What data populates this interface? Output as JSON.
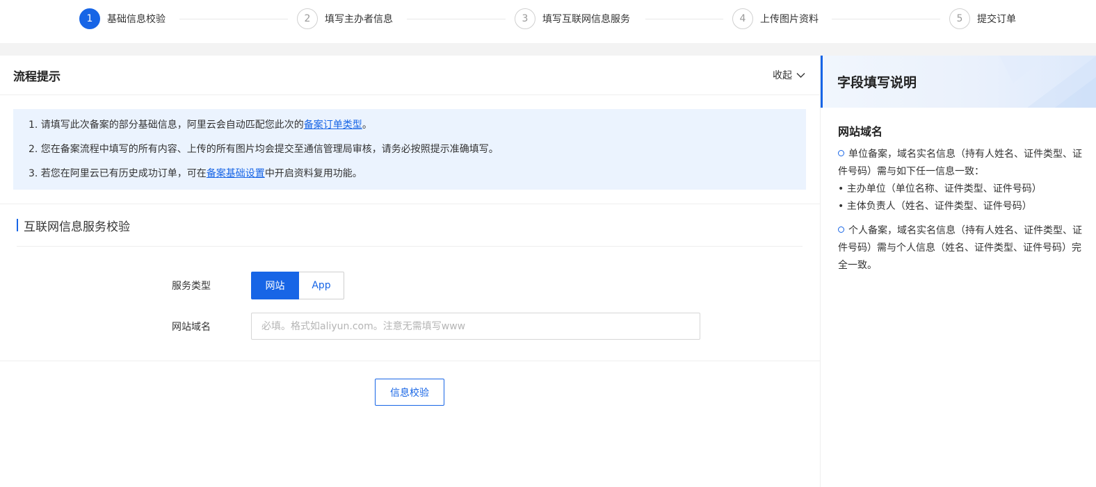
{
  "steps": [
    {
      "num": "1",
      "label": "基础信息校验",
      "active": true
    },
    {
      "num": "2",
      "label": "填写主办者信息",
      "active": false
    },
    {
      "num": "3",
      "label": "填写互联网信息服务",
      "active": false
    },
    {
      "num": "4",
      "label": "上传图片资料",
      "active": false
    },
    {
      "num": "5",
      "label": "提交订单",
      "active": false
    }
  ],
  "tips": {
    "title": "流程提示",
    "collapse_label": "收起",
    "line1_prefix": "1. 请填写此次备案的部分基础信息，阿里云会自动匹配您此次的",
    "line1_link": "备案订单类型",
    "line1_suffix": "。",
    "line2": "2. 您在备案流程中填写的所有内容、上传的所有图片均会提交至通信管理局审核，请务必按照提示准确填写。",
    "line3_prefix": "3. 若您在阿里云已有历史成功订单，可在",
    "line3_link": "备案基础设置",
    "line3_suffix": "中开启资料复用功能。"
  },
  "section": {
    "title": "互联网信息服务校验"
  },
  "form": {
    "service_type_label": "服务类型",
    "service_type_options": [
      "网站",
      "App"
    ],
    "service_type_selected": "网站",
    "domain_label": "网站域名",
    "domain_placeholder": "必填。格式如aliyun.com。注意无需填写www",
    "domain_value": ""
  },
  "verify_button": "信息校验",
  "side": {
    "title": "字段填写说明",
    "subtitle": "网站域名",
    "p1": "单位备案，域名实名信息（持有人姓名、证件类型、证件号码）需与如下任一信息一致：",
    "p1_item1": "• 主办单位（单位名称、证件类型、证件号码）",
    "p1_item2": "• 主体负责人（姓名、证件类型、证件号码）",
    "p2": "个人备案，域名实名信息（持有人姓名、证件类型、证件号码）需与个人信息（姓名、证件类型、证件号码）完全一致。"
  },
  "colors": {
    "accent": "#1765e6",
    "tips_bg": "#ebf3fe",
    "band": "#f3f3f3"
  }
}
